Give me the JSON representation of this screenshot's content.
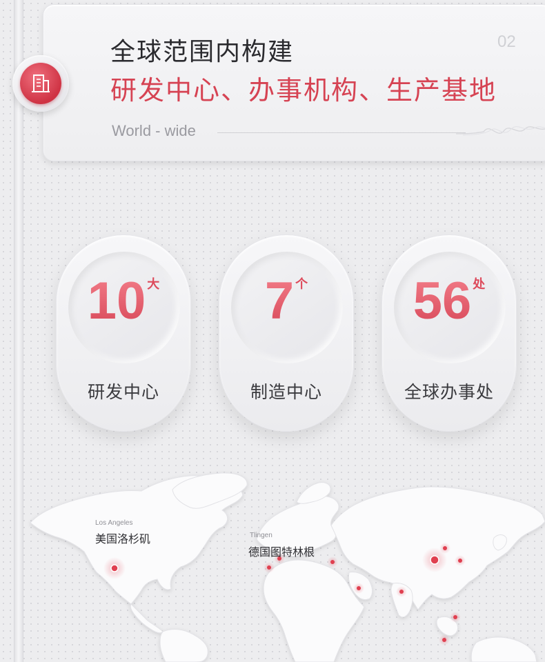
{
  "header": {
    "title_line1": "全球范围内构建",
    "title_line2": "研发中心、办事机构、生产基地",
    "page_number": "02",
    "subtitle": "World - wide",
    "badge_icon": "building-icon"
  },
  "stats": [
    {
      "value": "10",
      "unit": "大",
      "label": "研发中心"
    },
    {
      "value": "7",
      "unit": "个",
      "label": "制造中心"
    },
    {
      "value": "56",
      "unit": "处",
      "label": "全球办事处"
    }
  ],
  "map": {
    "locations": [
      {
        "name_en": "Los Angeles",
        "name_zh": "美国洛杉矶"
      },
      {
        "name_en": "Tlingen",
        "name_zh": "德国图特林根"
      }
    ]
  },
  "colors": {
    "accent": "#d64353",
    "background": "#ededef",
    "card": "#f4f4f6"
  }
}
